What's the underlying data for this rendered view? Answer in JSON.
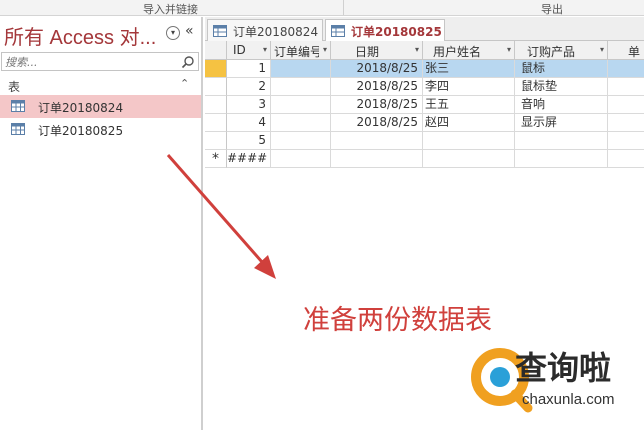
{
  "ribbon": {
    "group1": "导入并链接",
    "group2": "导出"
  },
  "nav": {
    "title": "所有 Access 对...",
    "collapse_glyph": "«",
    "dropdown_glyph": "▾",
    "search_placeholder": "搜索...",
    "group_label": "表",
    "group_chevron": "⌃",
    "items": [
      {
        "label": "订单20180824",
        "selected": true
      },
      {
        "label": "订单20180825",
        "selected": false
      }
    ]
  },
  "tabs": [
    {
      "label": "订单20180824",
      "active": false
    },
    {
      "label": "订单20180825",
      "active": true
    }
  ],
  "table": {
    "columns": [
      "ID",
      "订单编号",
      "日期",
      "用户姓名",
      "订购产品",
      "单"
    ],
    "rows": [
      {
        "id": "1",
        "order_no": "",
        "date": "2018/8/25",
        "user": "张三",
        "product": "鼠标"
      },
      {
        "id": "2",
        "order_no": "",
        "date": "2018/8/25",
        "user": "李四",
        "product": "鼠标垫"
      },
      {
        "id": "3",
        "order_no": "",
        "date": "2018/8/25",
        "user": "王五",
        "product": "音响"
      },
      {
        "id": "4",
        "order_no": "",
        "date": "2018/8/25",
        "user": "赵四",
        "product": "显示屏"
      },
      {
        "id": "5",
        "order_no": "",
        "date": "",
        "user": "",
        "product": ""
      }
    ],
    "new_row": {
      "marker": "*",
      "id": "####"
    }
  },
  "annotation": {
    "text": "准备两份数据表",
    "color": "#d0403c"
  },
  "watermark": {
    "name": "查询啦",
    "url": "chaxunla.com",
    "color": "#f0a020"
  },
  "colors": {
    "accent": "#a4373a",
    "selection": "#b8d7f0",
    "nav_selection": "#f4c7c8",
    "current_row": "#f5c242"
  }
}
